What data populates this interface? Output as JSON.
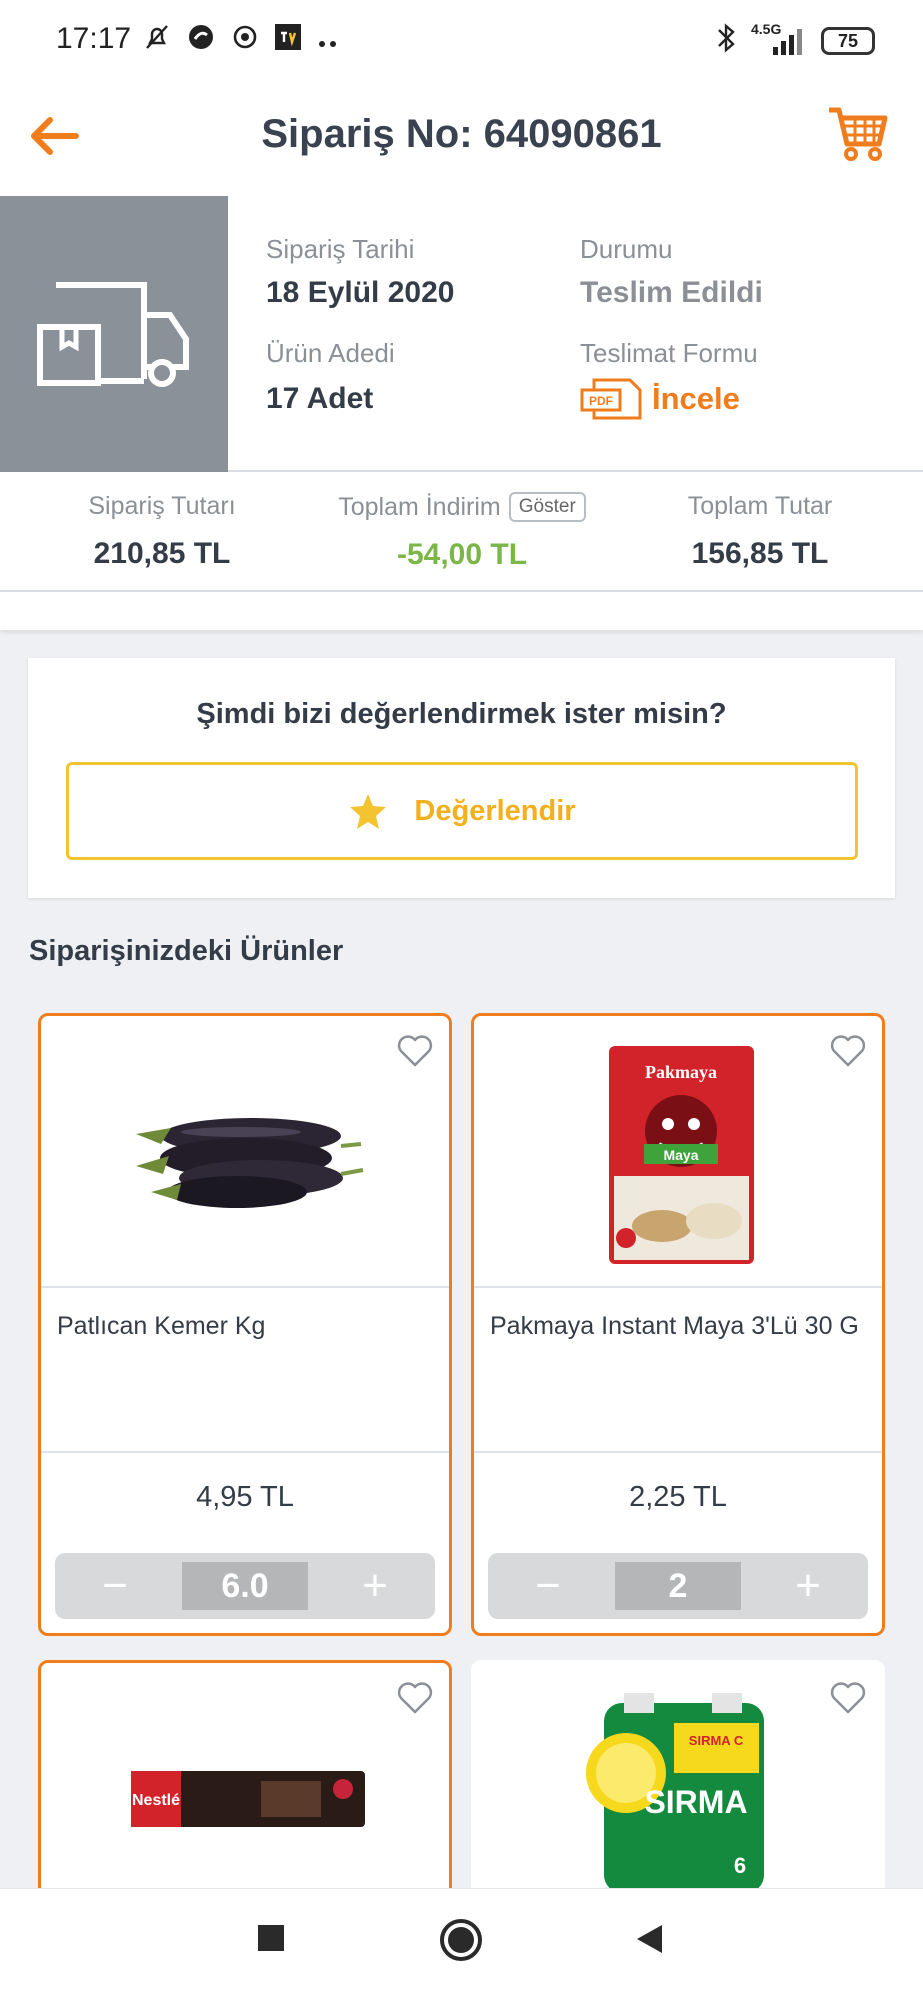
{
  "status_bar": {
    "time": "17:17",
    "network": "4.5G",
    "battery": "75"
  },
  "header": {
    "title": "Sipariş No: 64090861"
  },
  "order": {
    "date_label": "Sipariş Tarihi",
    "date_value": "18 Eylül 2020",
    "status_label": "Durumu",
    "status_value": "Teslim Edildi",
    "count_label": "Ürün Adedi",
    "count_value": "17 Adet",
    "delivery_label": "Teslimat Formu",
    "delivery_link": "İncele",
    "pdf_text": "PDF"
  },
  "totals": {
    "order_total_label": "Sipariş Tutarı",
    "order_total_value": "210,85 TL",
    "discount_label": "Toplam İndirim",
    "discount_show": "Göster",
    "discount_value": "-54,00 TL",
    "total_label": "Toplam Tutar",
    "total_value": "156,85 TL"
  },
  "rating": {
    "question": "Şimdi bizi değerlendirmek ister misin?",
    "button": "Değerlendir"
  },
  "products_section": {
    "title": "Siparişinizdeki Ürünler"
  },
  "products": [
    {
      "name": "Patlıcan Kemer Kg",
      "price": "4,95 TL",
      "qty": "6.0"
    },
    {
      "name": "Pakmaya Instant Maya 3'Lü 30 G",
      "price": "2,25 TL",
      "qty": "2"
    }
  ],
  "product_images": {
    "pakmaya_brand": "Pakmaya",
    "pakmaya_maya": "Maya",
    "nestle_brand": "Nestlé",
    "sirma_brand": "SIRMA",
    "sirma_tag": "SIRMA C",
    "sirma_count": "6"
  },
  "stepper": {
    "minus": "−",
    "plus": "+"
  },
  "colors": {
    "accent": "#f07d1d",
    "yellow": "#f4c430",
    "green": "#7ab648"
  }
}
